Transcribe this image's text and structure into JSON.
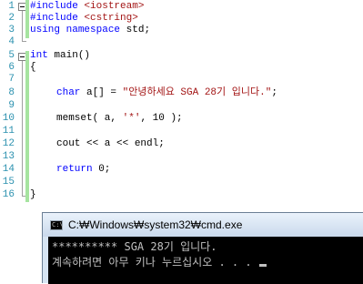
{
  "editor": {
    "line_numbers": [
      "1",
      "2",
      "3",
      "4",
      "5",
      "6",
      "7",
      "8",
      "9",
      "10",
      "11",
      "12",
      "13",
      "14",
      "15",
      "16"
    ],
    "code": {
      "l1_pre": "#include",
      "l1_inc": " <iostream>",
      "l2_pre": "#include",
      "l2_inc": " <cstring>",
      "l3_kw1": "using",
      "l3_kw2": "namespace",
      "l3_rest": " std;",
      "l5_kw": "int",
      "l5_rest": " main()",
      "l6": "{",
      "l8_kw": "char",
      "l8_mid": " a[] = ",
      "l8_str": "\"안녕하세요 SGA 28기 입니다.\"",
      "l8_end": ";",
      "l10_pre": "memset( a, ",
      "l10_str": "'*'",
      "l10_end": ", 10 );",
      "l12": "cout << a << endl;",
      "l14_kw": "return",
      "l14_rest": " 0;",
      "l16": "}"
    }
  },
  "cmd": {
    "title": "C:₩Windows₩system32₩cmd.exe",
    "output_line1": "********** SGA 28기 입니다.",
    "output_line2": "계속하려면 아무 키나 누르십시오 . . . "
  },
  "colors": {
    "keyword": "#0000ff",
    "string": "#a31515",
    "line_number": "#2b91af",
    "change_bar": "#a6e4a0",
    "console_bg": "#000000",
    "console_text": "#c0c0c0"
  }
}
